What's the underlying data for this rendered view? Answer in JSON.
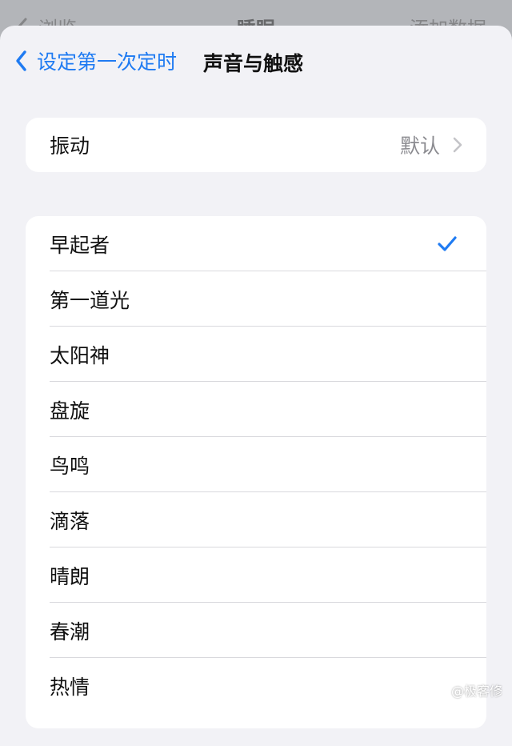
{
  "background_bar": {
    "back_label": "浏览",
    "title": "睡眠",
    "right_action": "添加数据"
  },
  "nav": {
    "back_label": "设定第一次定时",
    "title": "声音与触感"
  },
  "vibration": {
    "label": "振动",
    "value": "默认"
  },
  "tones": [
    {
      "label": "早起者",
      "selected": true
    },
    {
      "label": "第一道光",
      "selected": false
    },
    {
      "label": "太阳神",
      "selected": false
    },
    {
      "label": "盘旋",
      "selected": false
    },
    {
      "label": "鸟鸣",
      "selected": false
    },
    {
      "label": "滴落",
      "selected": false
    },
    {
      "label": "晴朗",
      "selected": false
    },
    {
      "label": "春潮",
      "selected": false
    },
    {
      "label": "热情",
      "selected": false
    }
  ],
  "watermark": "@极客修",
  "colors": {
    "accent": "#1f7bf2",
    "background": "#f2f2f6",
    "card": "#ffffff",
    "secondary_text": "#8b8b90"
  }
}
